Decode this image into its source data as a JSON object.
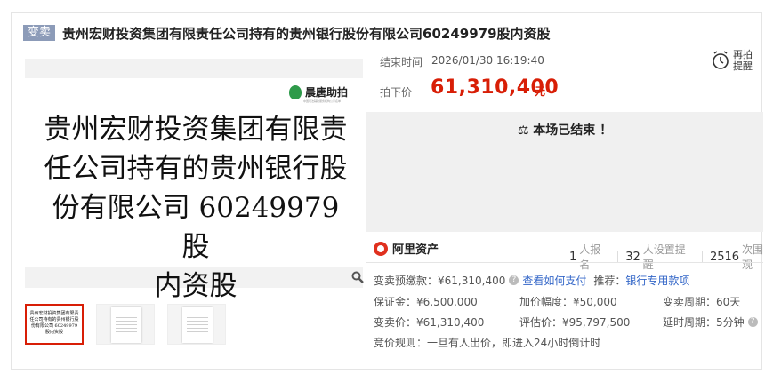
{
  "header": {
    "tag": "变卖",
    "title": "贵州宏财投资集团有限责任公司持有的贵州银行股份有限公司60249979股内资股"
  },
  "gallery": {
    "logo_name": "晨唐助拍",
    "logo_sub": "中国司法辅助服务机构公示名单",
    "main_lines": [
      "贵州宏财投资集团有限责",
      "任公司持有的贵州银行股",
      "份有限公司 60249979 股",
      "内资股"
    ],
    "thumb_text": "贵州宏财投资集团有限责任公司持有的贵州银行股份有限公司 60249979 股内资股"
  },
  "auction": {
    "end_time_label": "结束时间",
    "end_time": "2026/01/30 16:19:40",
    "price_label": "拍下价",
    "price": "61,310,400",
    "price_unit": "元",
    "remind_label": "再拍提醒",
    "status": "本场已结束 ！"
  },
  "platform": {
    "name": "阿里资产",
    "stats": [
      {
        "num": "1",
        "label": "人报名"
      },
      {
        "num": "32",
        "label": "人设置提醒"
      },
      {
        "num": "2516",
        "label": "次围观"
      }
    ]
  },
  "details": {
    "deposit_pay_label": "变卖预缴款：",
    "deposit_pay": "¥61,310,400",
    "how_to_pay": "查看如何支付",
    "recommend_label": "推荐：",
    "recommend_link": "银行专用款项",
    "margin": "保证金：¥6,500,000",
    "increment": "加价幅度：¥50,000",
    "period": "变卖周期：60天",
    "sale_price": "变卖价：¥61,310,400",
    "valuation": "评估价：¥95,797,500",
    "delay": "延时周期：5分钟",
    "rule": "竞价规则：一旦有人出价，即进入24小时倒计时"
  },
  "colors": {
    "accent": "#d81e06",
    "link": "#3467c8",
    "tag_bg": "#8c9bb8"
  }
}
